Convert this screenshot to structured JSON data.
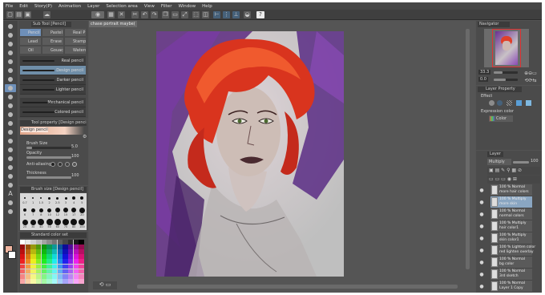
{
  "menu": [
    "File",
    "Edit",
    "Story(P)",
    "Animation",
    "Layer",
    "Selection area",
    "View",
    "Filter",
    "Window",
    "Help"
  ],
  "document_tab": "chase portrait maybe(",
  "subtool": {
    "title": "Sub Tool [Pencil]",
    "tabs": [
      "Pencil",
      "Pastel",
      "Real P",
      "Lead",
      "Erase",
      "Stamp",
      "Oil",
      "Gouache",
      "Watercolor"
    ],
    "brushes": [
      "Real pencil",
      "Design pencil",
      "Darker pencil",
      "Lighter pencil",
      "Mechanical pencil",
      "Colored pencil"
    ],
    "selected_brush": "Design pencil"
  },
  "tool_property": {
    "title": "Tool property [Design pencil]",
    "preview_label": "Design pencil",
    "brush_size_label": "Brush Size",
    "brush_size_value": "5.0",
    "opacity_label": "Opacity",
    "opacity_value": "100",
    "antialiasing_label": "Anti-aliasing",
    "thickness_label": "Thickness",
    "thickness_value": "100"
  },
  "brush_size_panel": {
    "title": "Brush size [Design pencil]",
    "sizes": [
      "0.7",
      "1",
      "1.5",
      "2",
      "2.5",
      "3",
      "4",
      "5",
      "6",
      "7",
      "8",
      "10",
      "12",
      "15",
      "17",
      "20",
      "25",
      "30",
      "40",
      "50",
      "60",
      "70",
      "80",
      "100"
    ]
  },
  "color_set": {
    "title": "Standard color set"
  },
  "navigator": {
    "title": "Navigator",
    "zoom_value": "33.3",
    "rotation_value": "0.0"
  },
  "layer_property": {
    "title": "Layer Property",
    "effect_label": "Effect",
    "expression_color_label": "Expression color",
    "color_value": "Color"
  },
  "layers_panel": {
    "tab": "Layer",
    "blend_mode": "Multiply",
    "opacity_value": "100",
    "layers": [
      {
        "mode": "100 % Normal",
        "name": "more hair colors",
        "selected": false
      },
      {
        "mode": "100 % Multiply",
        "name": "more skin",
        "selected": true
      },
      {
        "mode": "100 % Normal",
        "name": "normal colors",
        "selected": false
      },
      {
        "mode": "100 % Multiply",
        "name": "hair color1",
        "selected": false
      },
      {
        "mode": "100 % Multiply",
        "name": "skin color1",
        "selected": false
      },
      {
        "mode": "100 % Lighten color",
        "name": "red lighten overlay",
        "selected": false
      },
      {
        "mode": "100 % Normal",
        "name": "bg color",
        "selected": false
      },
      {
        "mode": "100 % Normal",
        "name": "3rd sketch",
        "selected": false
      },
      {
        "mode": "100 % Normal",
        "name": "Layer 1 Copy",
        "selected": false
      }
    ]
  },
  "colors": {
    "app_bg": "#535353",
    "selection": "#8aa6c2",
    "main_color": "#f0b5a0",
    "sub_color": "#ffffff"
  }
}
